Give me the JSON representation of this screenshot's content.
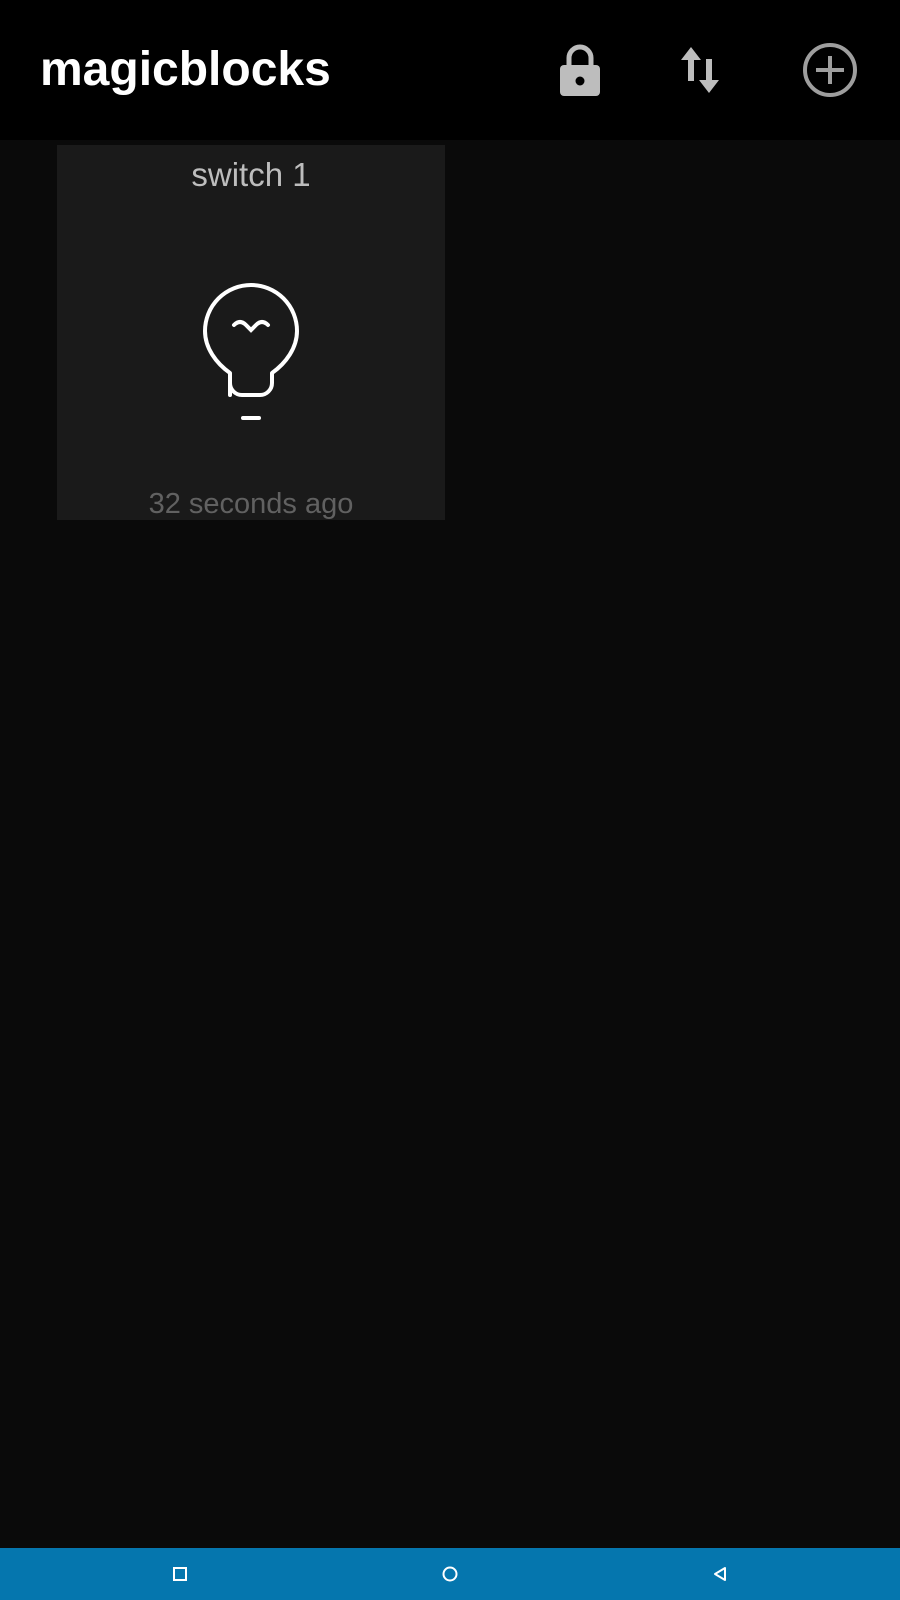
{
  "appbar": {
    "title": "magicblocks",
    "actions": [
      {
        "icon": "lock-icon"
      },
      {
        "icon": "sort-arrows-icon"
      },
      {
        "icon": "add-circle-icon"
      }
    ]
  },
  "tiles": [
    {
      "name": "switch 1",
      "icon": "lightbulb-icon",
      "last_updated": "32 seconds ago"
    }
  ],
  "navbar": {
    "buttons": [
      {
        "icon": "recents-square-icon"
      },
      {
        "icon": "home-circle-icon"
      },
      {
        "icon": "back-triangle-icon"
      }
    ]
  },
  "colors": {
    "appbar_bg": "#000000",
    "content_bg": "#0a0a0a",
    "tile_bg": "#1a1a1a",
    "navbar_bg": "#0576ae"
  }
}
